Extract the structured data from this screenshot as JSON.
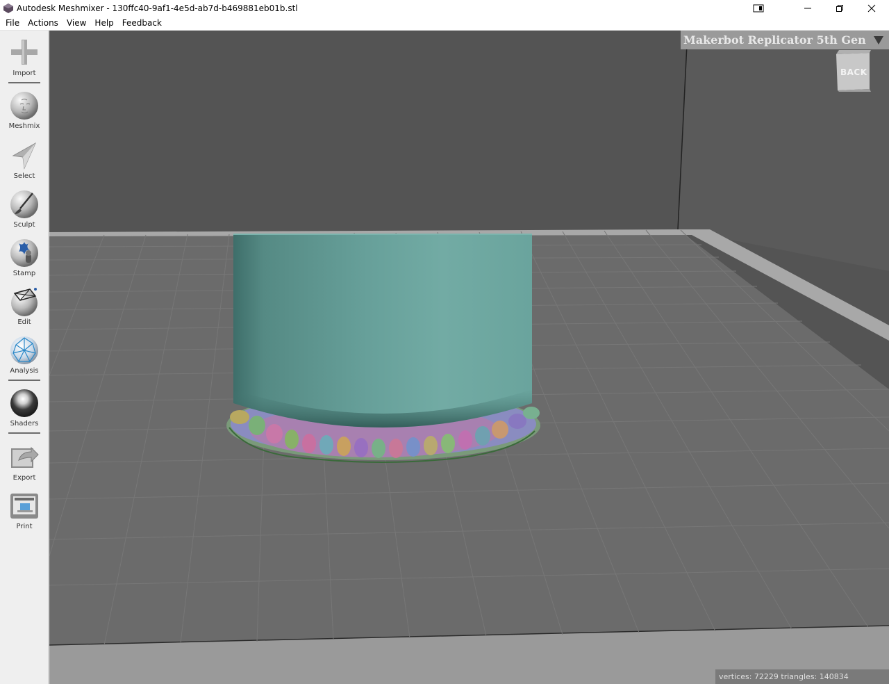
{
  "window": {
    "title": "Autodesk Meshmixer - 130ffc40-9af1-4e5d-ab7d-b469881eb01b.stl"
  },
  "menu": [
    "File",
    "Actions",
    "View",
    "Help",
    "Feedback"
  ],
  "tools": [
    {
      "label": "Import",
      "icon": "plus-icon"
    },
    {
      "label": "Meshmix",
      "icon": "face-sphere-icon"
    },
    {
      "label": "Select",
      "icon": "arrow-cursor-icon"
    },
    {
      "label": "Sculpt",
      "icon": "brush-sphere-icon"
    },
    {
      "label": "Stamp",
      "icon": "stamp-sphere-icon"
    },
    {
      "label": "Edit",
      "icon": "edit-sphere-icon"
    },
    {
      "label": "Analysis",
      "icon": "mesh-sphere-icon"
    },
    {
      "label": "Shaders",
      "icon": "chrome-sphere-icon"
    },
    {
      "label": "Export",
      "icon": "export-icon"
    },
    {
      "label": "Print",
      "icon": "printer-icon"
    }
  ],
  "printer": {
    "selected": "Makerbot Replicator 5th Gen"
  },
  "view_cube": {
    "face": "BACK"
  },
  "status": {
    "text": "vertices: 72229 triangles: 140834"
  },
  "colors": {
    "model": "#6aa8a0",
    "floor": "#6e6e6e",
    "background": "#545454"
  }
}
